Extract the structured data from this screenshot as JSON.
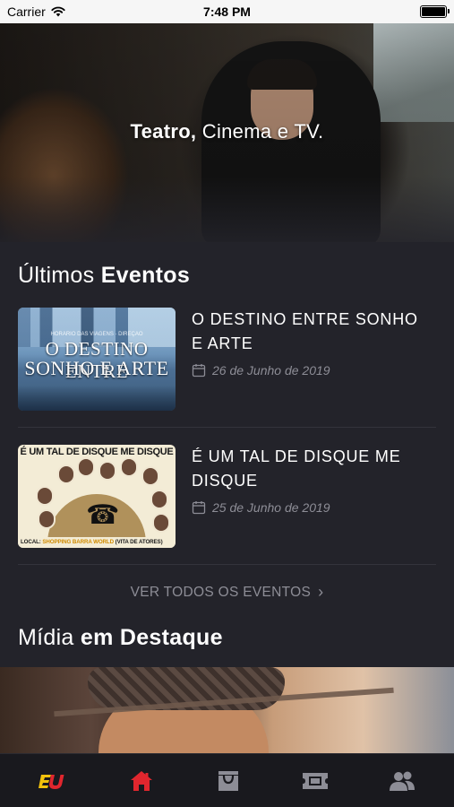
{
  "status_bar": {
    "carrier": "Carrier",
    "time": "7:48 PM"
  },
  "hero": {
    "tagline_bold": "Teatro,",
    "tagline_rest": " Cinema e TV."
  },
  "events_section": {
    "title_regular": "Últimos ",
    "title_bold": "Eventos"
  },
  "events": [
    {
      "title": "O DESTINO ENTRE SONHO E ARTE",
      "date": "26 de Junho de 2019",
      "thumbnail": {
        "line1": "O DESTINO ENTRE",
        "line2": "SONHO E ARTE",
        "small": "HORÁRIO DAS VIAGENS · DIREÇÃO"
      }
    },
    {
      "title": "É UM TAL DE DISQUE ME DISQUE",
      "date": "25 de Junho de 2019",
      "thumbnail": {
        "header": "É UM TAL DE DISQUE ME DISQUE",
        "footer_prefix": "LOCAL: ",
        "footer_highlight": "SHOPPING BARRA WORLD",
        "footer_suffix": " (VITA DE ATORES)"
      }
    }
  ],
  "see_all": {
    "label": "VER TODOS OS EVENTOS"
  },
  "media_section": {
    "title_regular": "Mídia ",
    "title_bold": "em Destaque"
  },
  "tab_bar": {
    "items": [
      {
        "icon": "brand-logo-icon",
        "active": false
      },
      {
        "icon": "home-icon",
        "active": true
      },
      {
        "icon": "bag-icon",
        "active": false
      },
      {
        "icon": "ticket-icon",
        "active": false
      },
      {
        "icon": "people-icon",
        "active": false
      }
    ]
  },
  "colors": {
    "background": "#23232a",
    "accent": "#e0262e",
    "muted": "#8d8d96",
    "tab_icon": "#8d8d96"
  }
}
